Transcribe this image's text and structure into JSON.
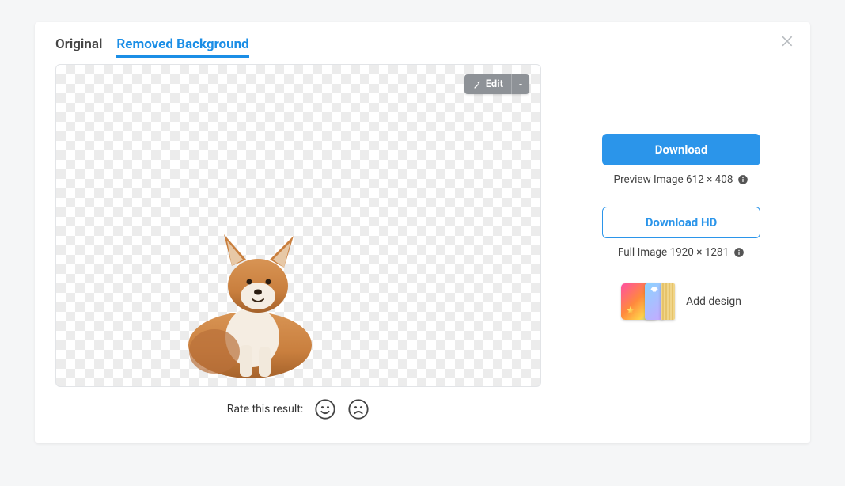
{
  "tabs": {
    "original": "Original",
    "removed": "Removed Background"
  },
  "edit": {
    "label": "Edit"
  },
  "rating": {
    "prompt": "Rate this result:"
  },
  "actions": {
    "download": "Download",
    "preview_caption": "Preview Image 612 × 408",
    "download_hd": "Download HD",
    "full_caption": "Full Image 1920 × 1281",
    "add_design": "Add design"
  }
}
